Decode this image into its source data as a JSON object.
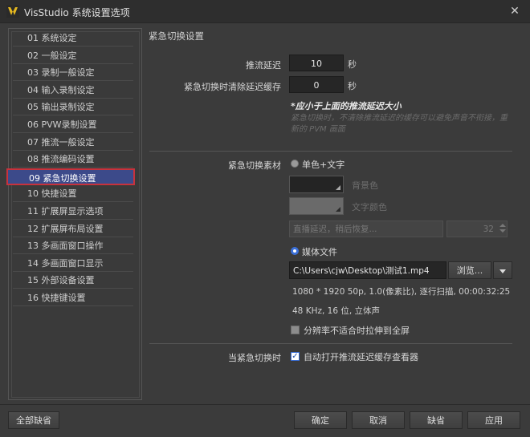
{
  "window": {
    "title": "VisStudio 系统设置选项"
  },
  "sidebar": {
    "items": [
      {
        "label": "01 系统设定"
      },
      {
        "label": "02 一般设定"
      },
      {
        "label": "03 录制一般设定"
      },
      {
        "label": "04 输入录制设定"
      },
      {
        "label": "05 输出录制设定"
      },
      {
        "label": "06 PVW录制设置"
      },
      {
        "label": "07 推流一般设定"
      },
      {
        "label": "08 推流编码设置"
      },
      {
        "label": "09 紧急切换设置"
      },
      {
        "label": "10 快捷设置"
      },
      {
        "label": "11 扩展屏显示选项"
      },
      {
        "label": "12 扩展屏布局设置"
      },
      {
        "label": "13 多画面窗口操作"
      },
      {
        "label": "14 多画面窗口显示"
      },
      {
        "label": "15 外部设备设置"
      },
      {
        "label": "16 快捷键设置"
      }
    ],
    "active_index": 8
  },
  "main": {
    "section_title": "紧急切换设置",
    "delay": {
      "label": "推流延迟",
      "value": "10",
      "unit": "秒"
    },
    "clear_cache": {
      "label": "紧急切换时清除延迟缓存",
      "value": "0",
      "unit": "秒"
    },
    "note_bold": "*应小于上面的推流延迟大小",
    "note_dim": "紧急切换时，不清除推流延迟的缓存可以避免声音不衔接，重新的 PVM 画面",
    "material": {
      "label": "紧急切换素材",
      "option_color": "单色+文字",
      "bg_color_label": "背景色",
      "text_color_label": "文字颜色",
      "text_placeholder": "直播延迟，稍后恢复...",
      "font_size": "32",
      "option_media": "媒体文件",
      "file_path": "C:\\Users\\cjw\\Desktop\\测试1.mp4",
      "browse_label": "浏览...",
      "info_line1": "1080 * 1920 50p, 1.0(像素比), 逐行扫描, 00:00:32:25",
      "info_line2": "48 KHz, 16 位, 立体声",
      "stretch_label": "分辨率不适合时拉伸到全屏",
      "stretch_checked": false
    },
    "on_switch": {
      "label": "当紧急切换时",
      "auto_open_label": "自动打开推流延迟缓存查看器",
      "auto_open_checked": true
    }
  },
  "footer": {
    "defaults_label": "全部缺省",
    "ok_label": "确定",
    "cancel_label": "取消",
    "default_label": "缺省",
    "apply_label": "应用"
  },
  "colors": {
    "accent": "#3a6fd8",
    "active_item": "#3c4a8a",
    "active_border": "#c8323c"
  }
}
